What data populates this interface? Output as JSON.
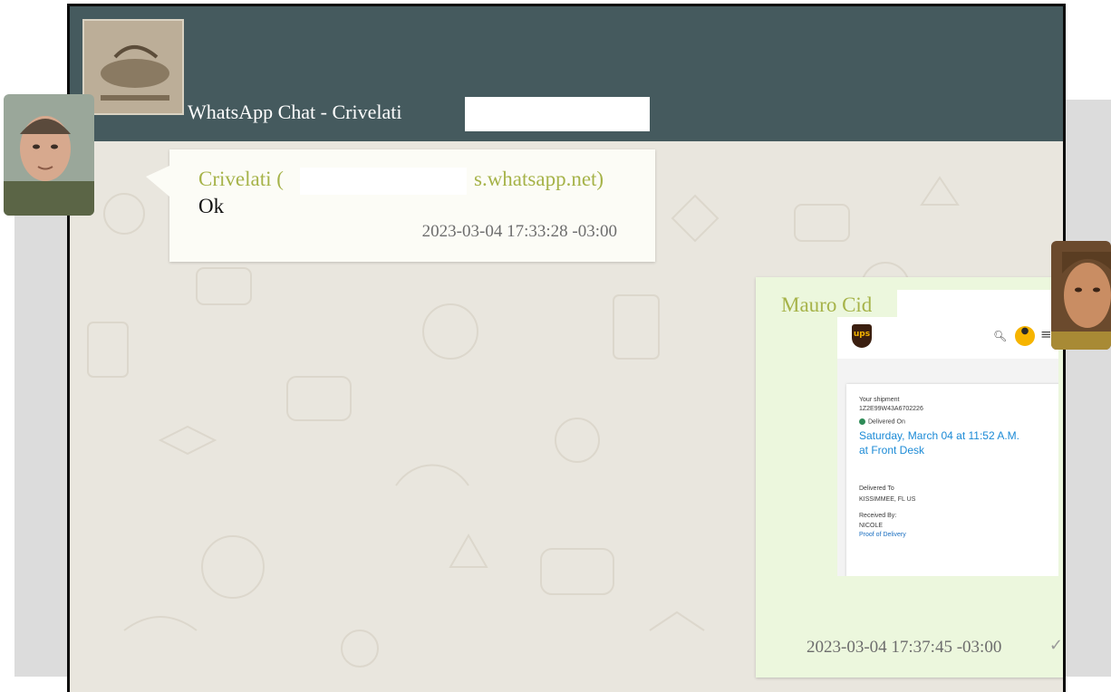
{
  "header": {
    "title": "WhatsApp Chat - Crivelati"
  },
  "messages": [
    {
      "direction": "incoming",
      "sender_name": "Crivelati (",
      "sender_suffix": "s.whatsapp.net)",
      "text": "Ok",
      "timestamp": "2023-03-04 17:33:28 -03:00"
    },
    {
      "direction": "outgoing",
      "sender_name": "Mauro Cid",
      "sender_suffix": ")",
      "attachment": {
        "logo": "ups",
        "shipment_label": "Your shipment",
        "tracking_number": "1Z2E99W43A6702226",
        "status_label": "Delivered On",
        "delivery_date": "Saturday, March 04 at 11:52 A.M.",
        "delivery_location": "at Front Desk",
        "delivered_to_label": "Delivered To",
        "delivered_to_value": "KISSIMMEE, FL US",
        "received_by_label": "Received By:",
        "received_by_value": "NICOLE",
        "proof_link": "Proof of Delivery"
      },
      "trailing_mark": "-",
      "timestamp": "2023-03-04 17:37:45 -03:00",
      "ticks": "✓✓"
    }
  ],
  "colors": {
    "header_bg": "#455a5e",
    "sender_name": "#a6b349",
    "incoming_bubble": "#fcfcf6",
    "outgoing_bubble": "#ecf7dd"
  }
}
